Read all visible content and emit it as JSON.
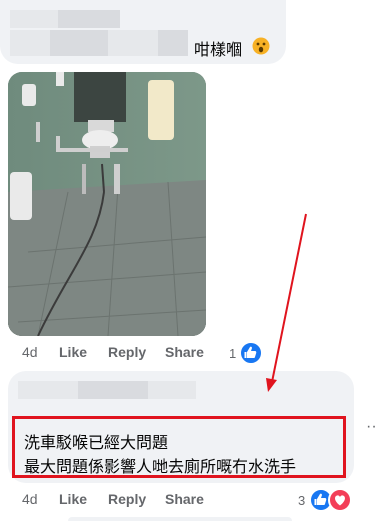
{
  "comment1": {
    "text": "咁樣嗰",
    "emoji_icon": "surprised-face-emoji"
  },
  "post_actions_1": {
    "time": "4d",
    "like": "Like",
    "reply": "Reply",
    "share": "Share",
    "reaction_count": "1",
    "reaction_icons": [
      "like-icon"
    ]
  },
  "comment2": {
    "line1": "洗車駁喉已經大問題",
    "line2": "最大問題係影響人哋去廁所嘅冇水洗手"
  },
  "post_actions_2": {
    "time": "4d",
    "like": "Like",
    "reply": "Reply",
    "share": "Share",
    "reaction_count": "3",
    "reaction_icons": [
      "like-icon",
      "love-icon"
    ]
  },
  "more_options": "··",
  "colors": {
    "bubble": "#f0f2f5",
    "accent_blue": "#1877f2",
    "love_red": "#f33e58",
    "highlight_red": "#e0141e",
    "meta_gray": "#65676b"
  }
}
